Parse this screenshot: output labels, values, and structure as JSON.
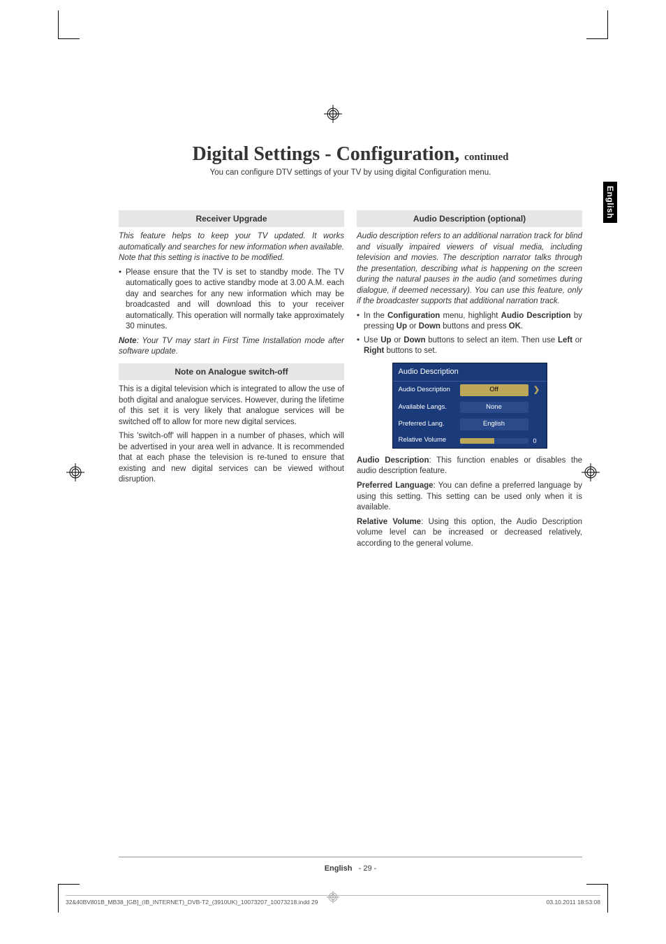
{
  "title_main": "Digital Settings - Configuration,",
  "title_cont": "continued",
  "subtitle": "You can configure DTV settings of your TV by using digital Configuration menu.",
  "sidetab": "English",
  "left": {
    "head1": "Receiver Upgrade",
    "intro1": "This feature helps to keep your TV updated. It works automatically and searches for new information when available. Note that this setting is inactive to be modified.",
    "bullet1": "Please ensure that the TV is set to standby mode. The TV automatically goes to active standby mode at 3.00 A.M. each day and searches for any new information which may be broadcasted and will download this to your receiver automatically. This operation will normally take approximately 30 minutes.",
    "note_label": "Note",
    "note_text": ": Your TV may start in First Time Installation mode after software update.",
    "head2": "Note on Analogue switch-off",
    "para1": "This is a digital television which is integrated to allow the use of both digital and analogue services. However, during the lifetime of this set it is very likely that analogue services will be switched off to allow for more new digital services.",
    "para2": "This 'switch-off' will happen in a number of phases, which will be advertised in your area well in advance. It is recommended that at each phase the television is re-tuned to ensure that existing and new digital services can be viewed without disruption."
  },
  "right": {
    "head1": "Audio Description (optional)",
    "intro1": "Audio description refers to an additional narration track for blind and visually impaired viewers of visual media, including television and movies. The description narrator talks through the presentation, describing what is happening on the screen during the natural pauses in the audio (and sometimes during dialogue, if deemed necessary). You can use this feature, only if the broadcaster supports that additional narration track.",
    "bullet1_pre": "In the ",
    "bullet1_b1": "Configuration",
    "bullet1_mid1": " menu, highlight ",
    "bullet1_b2": "Audio Description",
    "bullet1_mid2": " by pressing ",
    "bullet1_b3": "Up",
    "bullet1_mid3": " or ",
    "bullet1_b4": "Down",
    "bullet1_mid4": " buttons and press ",
    "bullet1_b5": "OK",
    "bullet1_end": ".",
    "bullet2_pre": "Use ",
    "bullet2_b1": "Up",
    "bullet2_mid1": " or ",
    "bullet2_b2": "Down",
    "bullet2_mid2": " buttons to select an item. Then use ",
    "bullet2_b3": "Left",
    "bullet2_mid3": " or ",
    "bullet2_b4": "Right",
    "bullet2_end": " buttons to set.",
    "menu": {
      "title": "Audio Description",
      "rows": [
        {
          "label": "Audio Description",
          "value": "Off",
          "selected": true
        },
        {
          "label": "Available Langs.",
          "value": "None",
          "selected": false
        },
        {
          "label": "Preferred Lang.",
          "value": "English",
          "selected": false
        },
        {
          "label": "Relative Volume",
          "value": "0",
          "slider": true
        }
      ]
    },
    "desc1_b": "Audio Description",
    "desc1": ": This function enables or disables the audio description feature.",
    "desc2_b": "Preferred Language",
    "desc2": ": You can define a preferred language by using this setting. This setting can be used only when it is available.",
    "desc3_b": "Relative Volume",
    "desc3": ": Using this option, the Audio Description volume level can be increased or decreased relatively, according to the general volume."
  },
  "footer": {
    "lang": "English",
    "page": "- 29 -",
    "imprint_left": "32&40BV801B_MB38_[GB]_(IB_INTERNET)_DVB-T2_(3910UK)_10073207_10073218.indd   29",
    "imprint_right": "03.10.2011   18:53:08"
  }
}
